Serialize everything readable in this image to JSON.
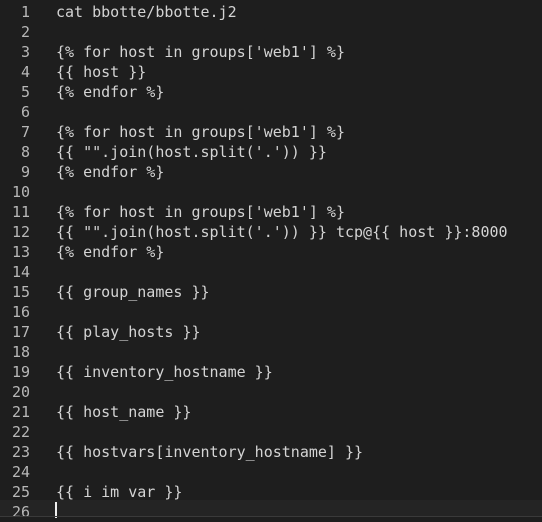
{
  "editor": {
    "lines": [
      {
        "number": "1",
        "text": "cat bbotte/bbotte.j2"
      },
      {
        "number": "2",
        "text": ""
      },
      {
        "number": "3",
        "text": "{% for host in groups['web1'] %}"
      },
      {
        "number": "4",
        "text": "{{ host }}"
      },
      {
        "number": "5",
        "text": "{% endfor %}"
      },
      {
        "number": "6",
        "text": ""
      },
      {
        "number": "7",
        "text": "{% for host in groups['web1'] %}"
      },
      {
        "number": "8",
        "text": "{{ \"\".join(host.split('.')) }}"
      },
      {
        "number": "9",
        "text": "{% endfor %}"
      },
      {
        "number": "10",
        "text": ""
      },
      {
        "number": "11",
        "text": "{% for host in groups['web1'] %}"
      },
      {
        "number": "12",
        "text": "{{ \"\".join(host.split('.')) }} tcp@{{ host }}:8000"
      },
      {
        "number": "13",
        "text": "{% endfor %}"
      },
      {
        "number": "14",
        "text": ""
      },
      {
        "number": "15",
        "text": "{{ group_names }}"
      },
      {
        "number": "16",
        "text": ""
      },
      {
        "number": "17",
        "text": "{{ play_hosts }}"
      },
      {
        "number": "18",
        "text": ""
      },
      {
        "number": "19",
        "text": "{{ inventory_hostname }}"
      },
      {
        "number": "20",
        "text": ""
      },
      {
        "number": "21",
        "text": "{{ host_name }}"
      },
      {
        "number": "22",
        "text": ""
      },
      {
        "number": "23",
        "text": "{{ hostvars[inventory_hostname] }}"
      },
      {
        "number": "24",
        "text": ""
      },
      {
        "number": "25",
        "text": "{{ i_im_var }}"
      },
      {
        "number": "26",
        "text": ""
      }
    ],
    "current_line": 26,
    "colors": {
      "background": "#1e1e1e",
      "text": "#d4d4d4",
      "line_number": "#b8b8b8",
      "cursor": "#f0f0f0"
    }
  }
}
